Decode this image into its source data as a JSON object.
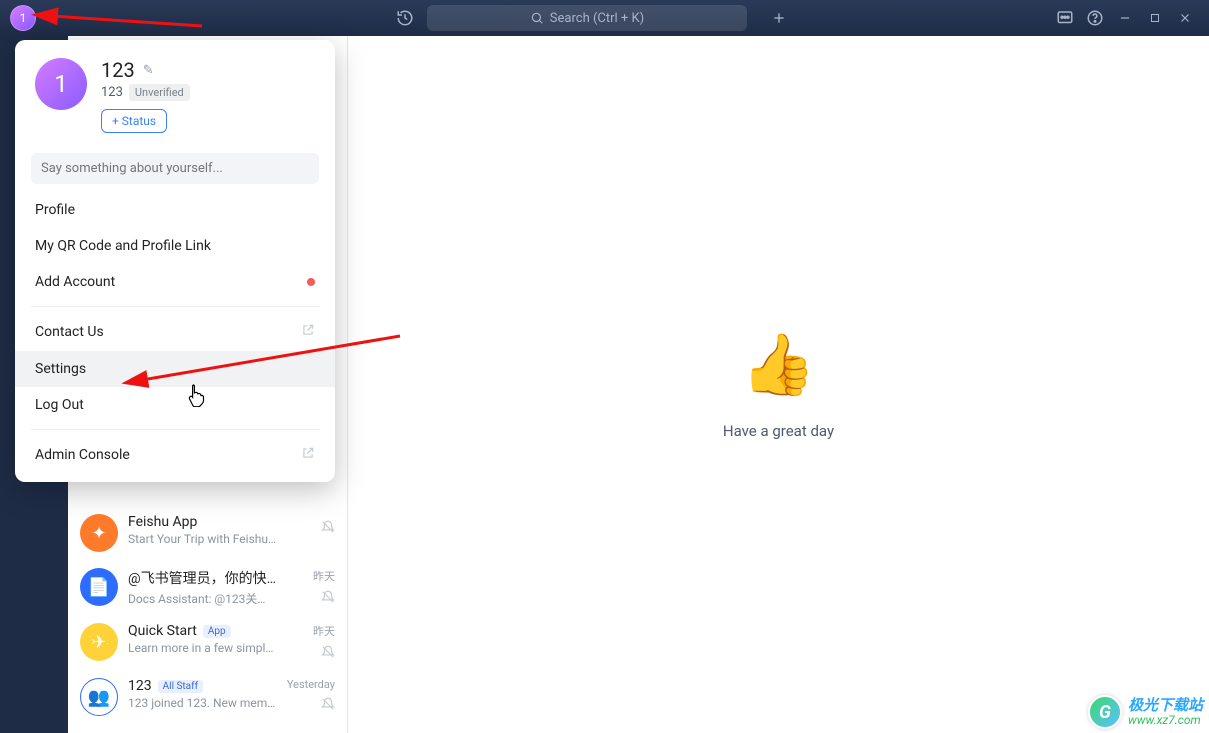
{
  "titlebar": {
    "avatar_initial": "1",
    "search_placeholder": "Search (Ctrl + K)"
  },
  "popover": {
    "avatar_initial": "1",
    "name": "123",
    "id": "123",
    "unverified_label": "Unverified",
    "status_btn": "+ Status",
    "bio_placeholder": "Say something about yourself...",
    "menu": {
      "profile": "Profile",
      "qr": "My QR Code and Profile Link",
      "add_account": "Add Account",
      "contact": "Contact Us",
      "settings": "Settings",
      "logout": "Log Out",
      "admin": "Admin Console"
    }
  },
  "chats": [
    {
      "title": "Feishu App",
      "sub": "Start Your Trip with Feishu Ap…",
      "time": "",
      "badge": "",
      "avatarColor": "#ff7a2b",
      "avatarGlyph": "✦"
    },
    {
      "title": "@飞书管理员，你的快速…",
      "sub": "Docs Assistant: @123关注飞…",
      "time": "昨天",
      "badge": "",
      "avatarColor": "#2d6cff",
      "avatarGlyph": "📄"
    },
    {
      "title": "Quick Start",
      "sub": "Learn more in a few simple st…",
      "time": "昨天",
      "badge": "App",
      "avatarColor": "#ffd23a",
      "avatarGlyph": "✈"
    },
    {
      "title": "123",
      "sub": "123 joined 123. New member…",
      "time": "Yesterday",
      "badge": "All Staff",
      "avatarColor": "#fff",
      "avatarGlyph": "👥"
    }
  ],
  "content": {
    "greeting": "Have a great day"
  },
  "watermark": {
    "line1": "极光下载站",
    "line2": "www.xz7.com"
  }
}
